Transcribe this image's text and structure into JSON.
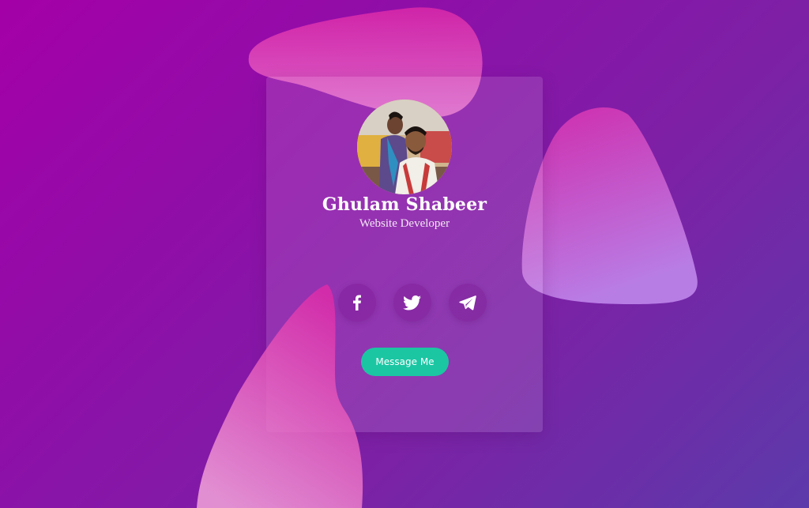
{
  "profile": {
    "name": "Ghulam Shabeer",
    "role": "Website Developer",
    "avatar_icon": "profile-photo"
  },
  "social": [
    {
      "icon": "facebook-icon"
    },
    {
      "icon": "twitter-icon"
    },
    {
      "icon": "telegram-icon"
    }
  ],
  "message_button": {
    "label": "Message Me",
    "color": "#1bc6a3"
  },
  "colors": {
    "background_start": "#a400a8",
    "background_end": "#5c3aaa",
    "blob_pink": "#e040b0",
    "text": "#ffffff"
  }
}
